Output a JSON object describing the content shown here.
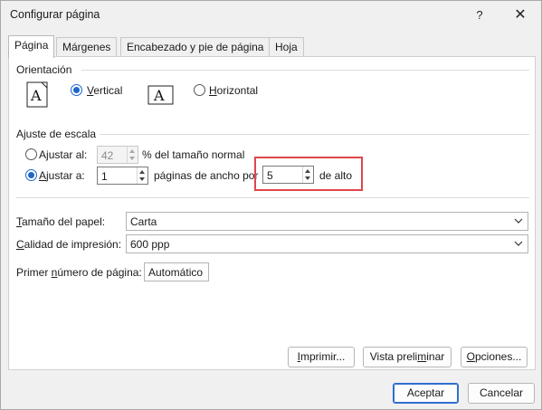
{
  "window": {
    "title": "Configurar página",
    "help_glyph": "?",
    "close_glyph": "✕"
  },
  "tabs": [
    {
      "label": "Página",
      "active": true
    },
    {
      "label": "Márgenes",
      "active": false
    },
    {
      "label": "Encabezado y pie de página",
      "active": false
    },
    {
      "label": "Hoja",
      "active": false
    }
  ],
  "orientation": {
    "group_label": "Orientación",
    "vertical_label_u": "V",
    "vertical_label_rest": "ertical",
    "horizontal_label_u": "H",
    "horizontal_label_rest": "orizontal",
    "selected": "vertical",
    "icon_letter": "A"
  },
  "scaling": {
    "group_label": "Ajuste de escala",
    "adjust_to_label_pre": "A",
    "adjust_to_label_u": "j",
    "adjust_to_label_post": "ustar al:",
    "adjust_to_value": "42",
    "adjust_to_suffix": "% del tamaño normal",
    "fit_to_label_pre": "",
    "fit_to_label_u": "A",
    "fit_to_label_post": "justar a:",
    "pages_wide_value": "1",
    "pages_wide_label": "páginas de ancho por",
    "pages_tall_value": "5",
    "pages_tall_label": "de alto",
    "selected": "fit_to"
  },
  "paper": {
    "paper_size_label_u": "T",
    "paper_size_label_rest": "amaño del papel:",
    "paper_size_value": "Carta",
    "print_quality_label_u": "C",
    "print_quality_label_rest": "alidad de impresión:",
    "print_quality_value": "600 ppp",
    "first_page_label_pre": "Primer ",
    "first_page_label_u": "n",
    "first_page_label_post": "úmero de página:",
    "first_page_value": "Automático"
  },
  "panel_buttons": {
    "print_u": "I",
    "print_rest": "mprimir...",
    "preview_pre": "Vista preli",
    "preview_u": "m",
    "preview_post": "inar",
    "options_u": "O",
    "options_rest": "pciones..."
  },
  "footer": {
    "accept_label": "Aceptar",
    "cancel_label": "Cancelar"
  },
  "colors": {
    "accent": "#1f66c9",
    "highlight": "#e0454c"
  }
}
